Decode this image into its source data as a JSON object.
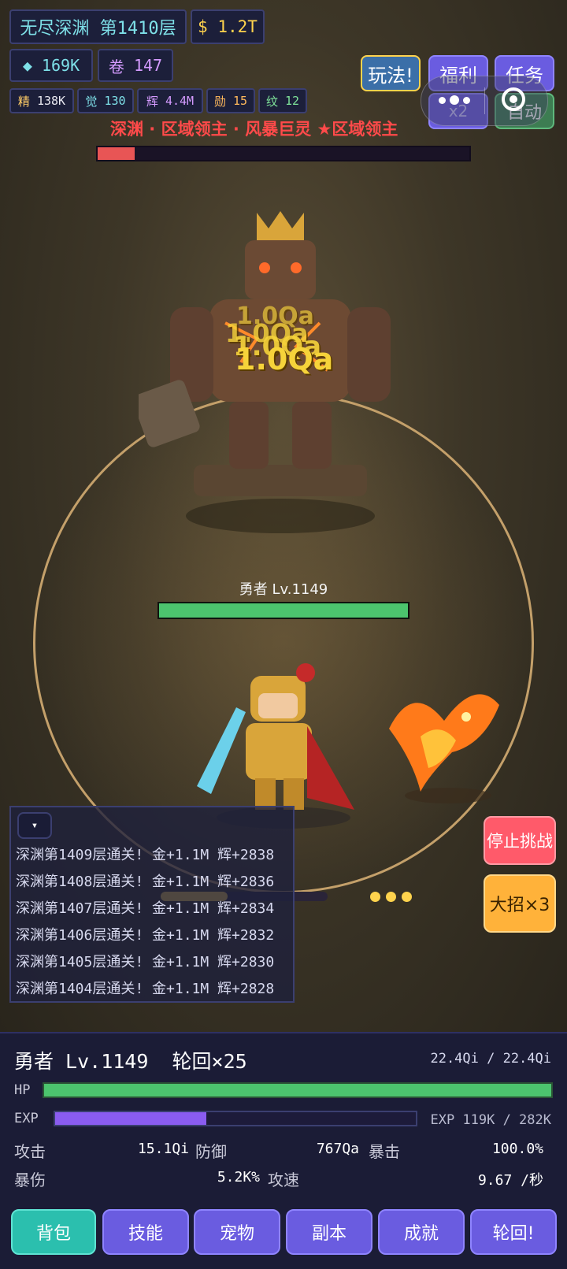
{
  "header": {
    "realm": "无尽深渊 第1410层",
    "gold_icon": "$",
    "gold": "1.2T",
    "gem_icon": "◆",
    "gems": "169K",
    "scroll_icon": "卷",
    "scrolls": "147",
    "stats": [
      {
        "label": "精",
        "value": "138K"
      },
      {
        "label": "觉",
        "value": "130"
      },
      {
        "label": "辉",
        "value": "4.4M"
      },
      {
        "label": "勋",
        "value": "15"
      },
      {
        "label": "纹",
        "value": "12"
      }
    ]
  },
  "top_buttons": {
    "play": "玩法!",
    "welfare": "福利",
    "tasks": "任务",
    "speed": "x2",
    "auto": "自动"
  },
  "boss": {
    "title": "深渊 · 区域领主 · 风暴巨灵 ★区域领主",
    "hp_fraction": 0.1,
    "damage_numbers": [
      "1.0Qa",
      "1.0Qa",
      "1.0Qa",
      "1.0Qa"
    ]
  },
  "hero": {
    "tag": "勇者 Lv.1149",
    "hp_fraction": 1.0
  },
  "log": {
    "toggle_icon": "▾",
    "lines": [
      "深渊第1409层通关! 金+1.1M 辉+2838",
      "深渊第1408层通关! 金+1.1M 辉+2836",
      "深渊第1407层通关! 金+1.1M 辉+2834",
      "深渊第1406层通关! 金+1.1M 辉+2832",
      "深渊第1405层通关! 金+1.1M 辉+2830",
      "深渊第1404层通关! 金+1.1M 辉+2828"
    ]
  },
  "actions": {
    "stop": "停止挑战",
    "ultimate": "大招×3"
  },
  "skill_bar": {
    "fill_fraction": 0.4
  },
  "panel": {
    "name": "勇者 Lv.1149  轮回×25",
    "hp_text": "22.4Qi / 22.4Qi",
    "hp_label": "HP",
    "hp_fraction": 1.0,
    "exp_label": "EXP",
    "exp_text": "EXP 119K / 282K",
    "exp_fraction": 0.42,
    "atk_label": "攻击",
    "atk": "15.1Qi",
    "def_label": "防御",
    "def": "767Qa",
    "crit_label": "暴击",
    "crit": "100.0%",
    "critdmg_label": "暴伤",
    "critdmg": "5.2K%",
    "aspd_label": "攻速",
    "aspd": "9.67 /秒"
  },
  "nav": [
    "背包",
    "技能",
    "宠物",
    "副本",
    "成就",
    "轮回!"
  ],
  "colors": {
    "accent": "#6a5ce0",
    "active_tab": "#2bbfae",
    "hp": "#4cc46e",
    "exp": "#8a5cf0",
    "boss_hp": "#e85555",
    "stop": "#ff5a6a",
    "ultimate": "#ffb23a"
  }
}
